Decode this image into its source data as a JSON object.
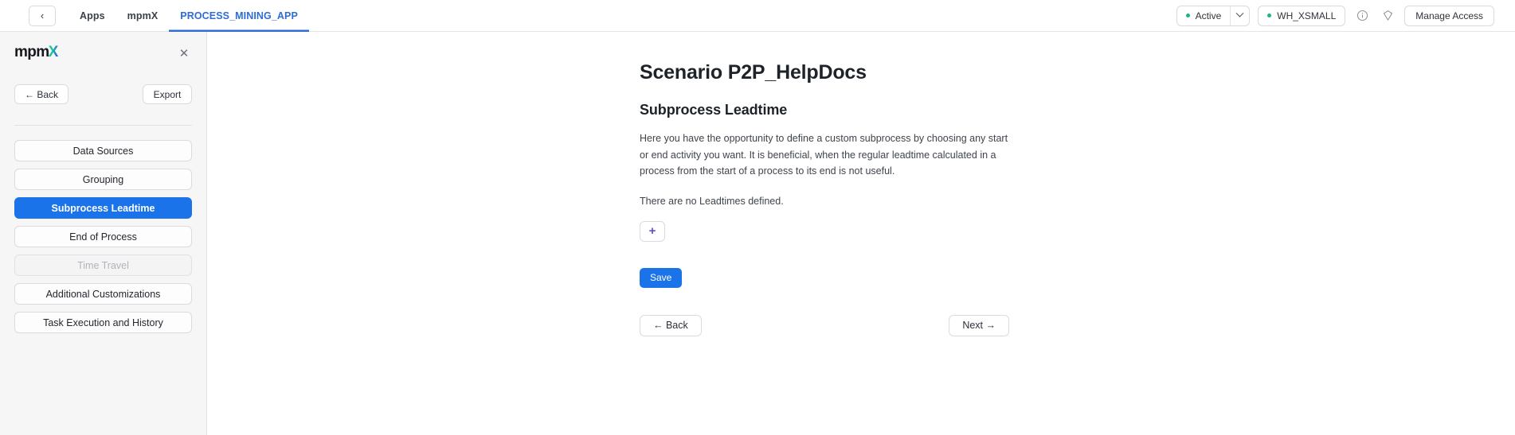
{
  "topbar": {
    "back_label": "‹",
    "breadcrumbs": [
      {
        "label": "Apps",
        "active": false
      },
      {
        "label": "mpmX",
        "active": false
      },
      {
        "label": "PROCESS_MINING_APP",
        "active": true
      }
    ],
    "status": {
      "label": "Active",
      "dot_color": "#1fb57a"
    },
    "warehouse": {
      "label": "WH_XSMALL",
      "dot_color": "#1fb57a"
    },
    "info_icon": "info-icon",
    "shield_icon": "shield-icon",
    "manage_access_label": "Manage Access",
    "accent_color": "#2f6cd4"
  },
  "sidebar": {
    "logo_main": "mpm",
    "logo_accent": "X",
    "close_label": "✕",
    "back_label": "← Back",
    "export_label": "Export",
    "items": [
      {
        "label": "Data Sources",
        "state": "normal"
      },
      {
        "label": "Grouping",
        "state": "normal"
      },
      {
        "label": "Subprocess Leadtime",
        "state": "selected"
      },
      {
        "label": "End of Process",
        "state": "normal"
      },
      {
        "label": "Time Travel",
        "state": "disabled"
      },
      {
        "label": "Additional Customizations",
        "state": "normal"
      },
      {
        "label": "Task Execution and History",
        "state": "normal"
      }
    ],
    "selected_color": "#1a73e8"
  },
  "main": {
    "scenario_title": "Scenario P2P_HelpDocs",
    "section_title": "Subprocess Leadtime",
    "description": "Here you have the opportunity to define a custom subprocess by choosing any start or end activity you want. It is beneficial, when the regular leadtime calculated in a process from the start of a process to its end is not useful.",
    "empty_state": "There are no Leadtimes defined.",
    "add_label": "+",
    "add_icon_color": "#5b4bd6",
    "save_label": "Save",
    "save_color": "#1a73e8",
    "back_label": "← Back",
    "next_label": "Next →"
  }
}
